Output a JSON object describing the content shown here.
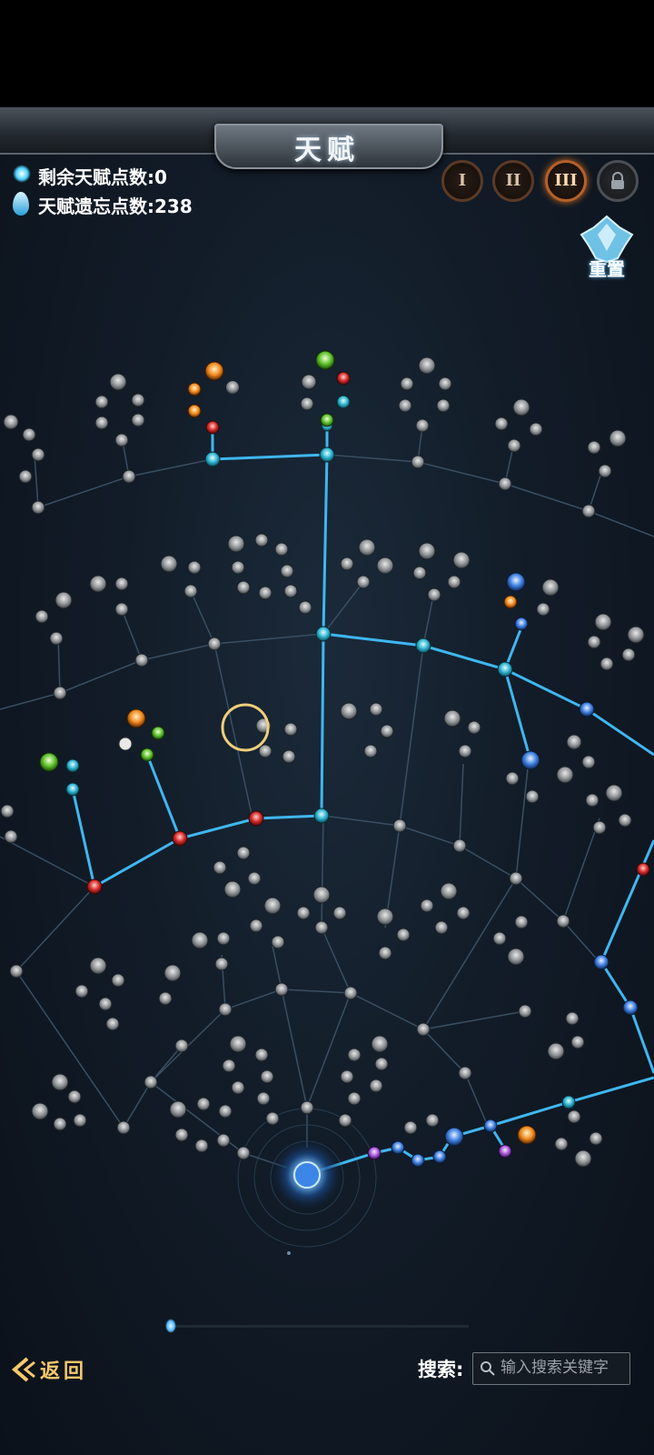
{
  "header": {
    "title": "天赋"
  },
  "stats": {
    "remaining_points": "剩余天赋点数:0",
    "forget_points": "天赋遗忘点数:238"
  },
  "tiers": [
    {
      "label": "I",
      "state": "available"
    },
    {
      "label": "II",
      "state": "available"
    },
    {
      "label": "III",
      "state": "selected"
    },
    {
      "label": "",
      "state": "locked",
      "icon": "lock-icon"
    }
  ],
  "reset": {
    "label": "重置",
    "icon": "crystal-reset-icon"
  },
  "footer": {
    "back_label": "返回",
    "search_label": "搜索:",
    "search_placeholder": "输入搜索关键字"
  },
  "colors": {
    "active_path": "#3fb7f0",
    "inactive_path": "#3a4f63",
    "accent_gold": "#f7c86a",
    "tier_active": "#d06a22"
  }
}
